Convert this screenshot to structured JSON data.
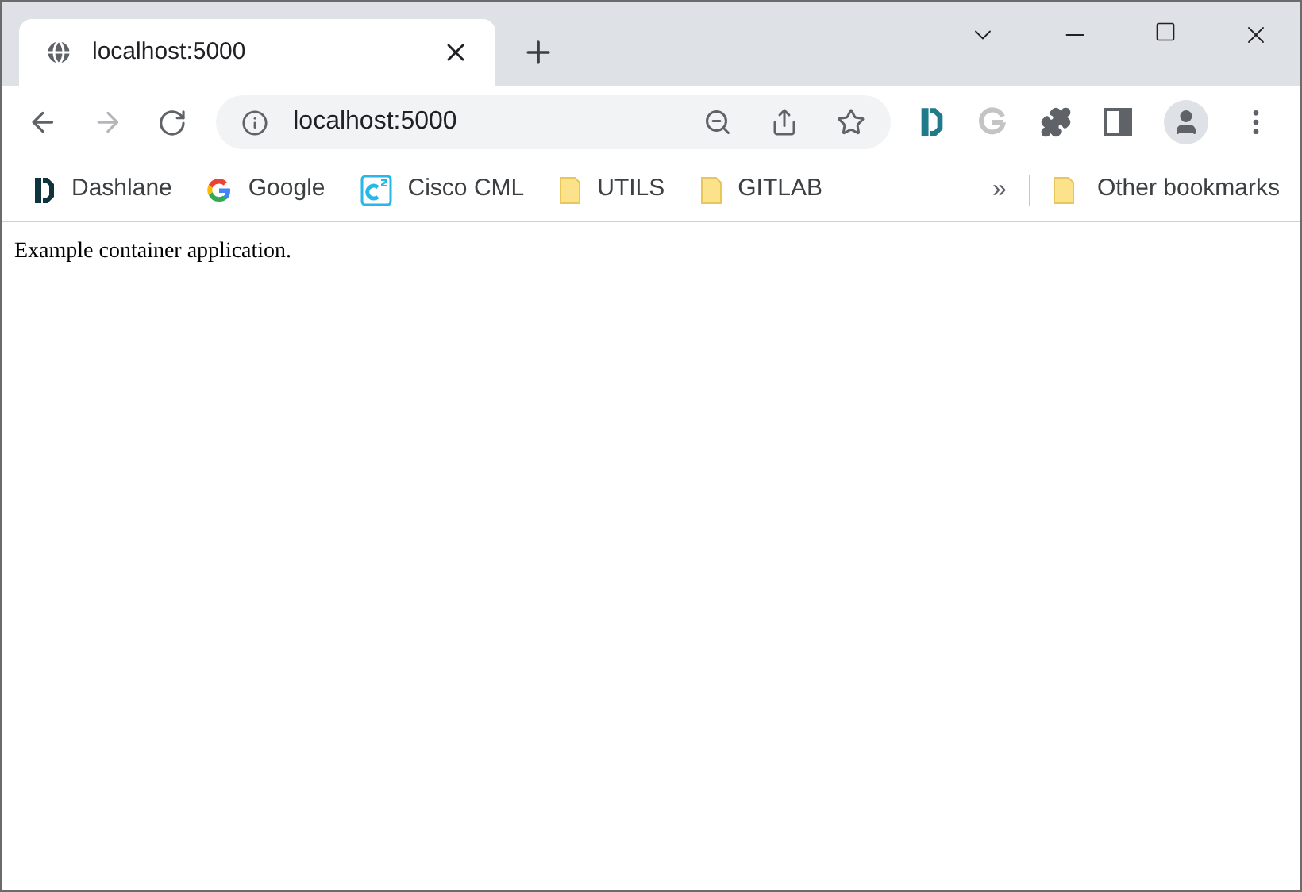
{
  "tabs": [
    {
      "title": "localhost:5000",
      "selected": true
    }
  ],
  "address_bar": {
    "url": "localhost:5000"
  },
  "bookmarks": [
    {
      "label": "Dashlane",
      "kind": "dashlane"
    },
    {
      "label": "Google",
      "kind": "google"
    },
    {
      "label": "Cisco CML",
      "kind": "cisco"
    },
    {
      "label": "UTILS",
      "kind": "folder"
    },
    {
      "label": "GITLAB",
      "kind": "folder"
    }
  ],
  "bookmarks_overflow": "»",
  "other_bookmarks": "Other bookmarks",
  "page": {
    "text": "Example container application."
  }
}
